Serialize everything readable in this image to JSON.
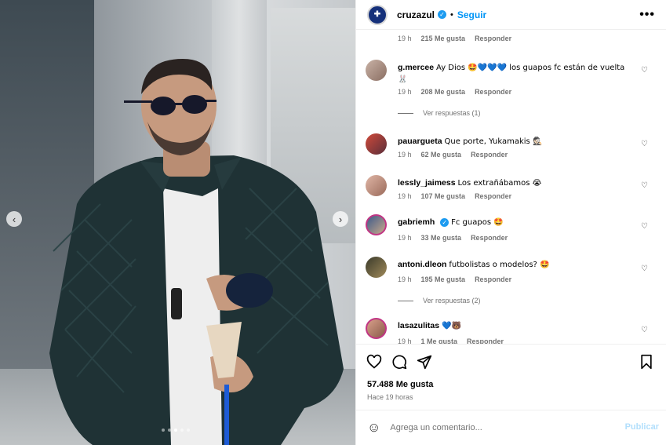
{
  "post": {
    "carousel": {
      "prev_icon": "chevron-left-icon",
      "next_icon": "chevron-right-icon",
      "slide_count": 5,
      "active_slide": 4
    }
  },
  "header": {
    "username": "cruzazul",
    "separator": "•",
    "follow_label": "Seguir",
    "more_label": "•••"
  },
  "top_meta": {
    "time": "19 h",
    "likes": "215 Me gusta",
    "reply": "Responder"
  },
  "comments": [
    {
      "user": "g.mercee",
      "text": "Ay Dios 🤩💙💙💙 los guapos fc están de vuelta 🐰",
      "time": "19 h",
      "likes": "208 Me gusta",
      "reply": "Responder",
      "replies": "Ver respuestas (1)"
    },
    {
      "user": "pauargueta",
      "text": "Que porte, Yukamakis 🕵🏻",
      "time": "19 h",
      "likes": "62 Me gusta",
      "reply": "Responder"
    },
    {
      "user": "lessly_jaimess",
      "text": "Los extrañábamos 😭",
      "time": "19 h",
      "likes": "107 Me gusta",
      "reply": "Responder"
    },
    {
      "user": "gabriemh",
      "text": "Fc guapos 🤩",
      "time": "19 h",
      "likes": "33 Me gusta",
      "reply": "Responder",
      "verified": true
    },
    {
      "user": "antoni.dleon",
      "text": "futbolistas o modelos? 🤩",
      "time": "19 h",
      "likes": "195 Me gusta",
      "reply": "Responder",
      "replies": "Ver respuestas (2)"
    },
    {
      "user": "lasazulitas",
      "text": "💙🐻",
      "time": "19 h",
      "likes": "1 Me gusta",
      "reply": "Responder"
    }
  ],
  "actions": {
    "likes": "57.488 Me gusta",
    "time": "Hace 19 horas"
  },
  "add_comment": {
    "placeholder": "Agrega un comentario...",
    "publish_label": "Publicar"
  },
  "colors": {
    "accent": "#0095f6",
    "verified": "#1d9bf0"
  }
}
